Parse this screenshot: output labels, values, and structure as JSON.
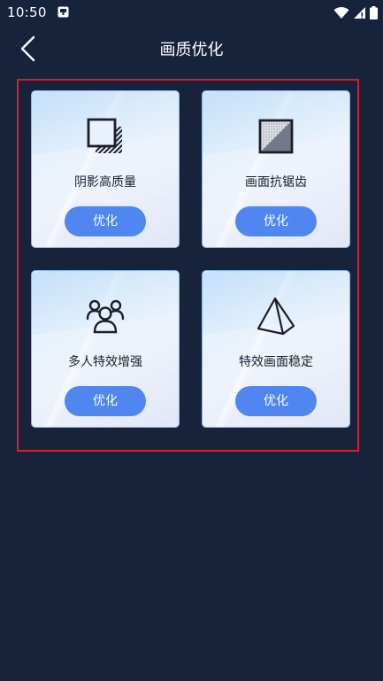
{
  "status_bar": {
    "time": "10:50"
  },
  "header": {
    "title": "画质优化"
  },
  "cards": [
    {
      "label": "阴影高质量",
      "button": "优化",
      "icon": "shadow-layers-icon"
    },
    {
      "label": "画面抗锯齿",
      "button": "优化",
      "icon": "anti-alias-grid-icon"
    },
    {
      "label": "多人特效增强",
      "button": "优化",
      "icon": "multi-user-icon"
    },
    {
      "label": "特效画面稳定",
      "button": "优化",
      "icon": "pyramid-icon"
    }
  ],
  "colors": {
    "background": "#17223b",
    "accent_button": "#4f86f0",
    "highlight_border": "#d5202a"
  }
}
